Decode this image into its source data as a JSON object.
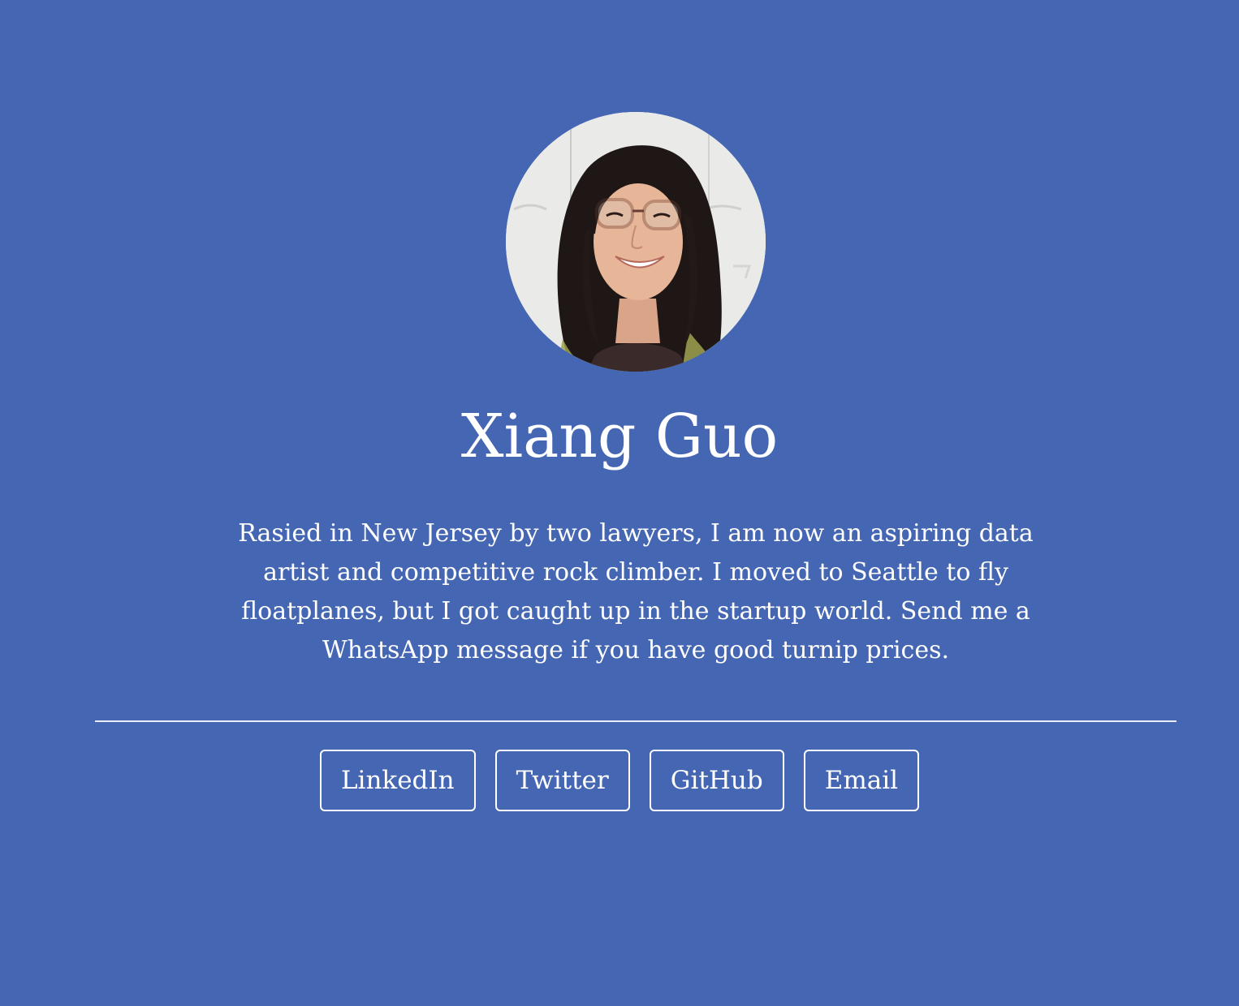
{
  "profile": {
    "name": "Xiang Guo",
    "bio": "Rasied in New Jersey by two lawyers, I am now an aspiring data artist and competitive rock climber. I moved to Seattle to fly floatplanes, but I got caught up in the startup world. Send me a WhatsApp message if you have good turnip prices."
  },
  "links": [
    {
      "label": "LinkedIn"
    },
    {
      "label": "Twitter"
    },
    {
      "label": "GitHub"
    },
    {
      "label": "Email"
    }
  ],
  "colors": {
    "background": "#4466b3",
    "text": "#ffffff",
    "divider": "#e8ecf6"
  }
}
